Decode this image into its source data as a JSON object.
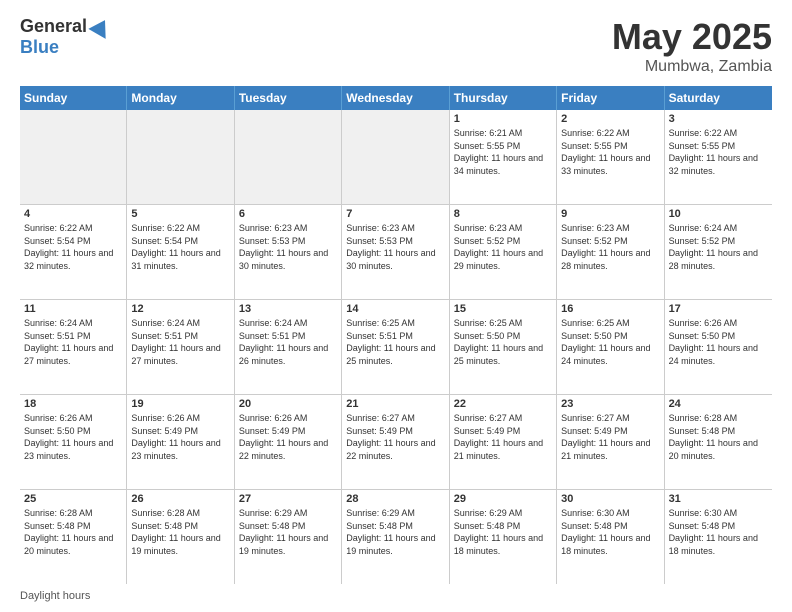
{
  "logo": {
    "general": "General",
    "blue": "Blue"
  },
  "title": {
    "month": "May 2025",
    "location": "Mumbwa, Zambia"
  },
  "header_days": [
    "Sunday",
    "Monday",
    "Tuesday",
    "Wednesday",
    "Thursday",
    "Friday",
    "Saturday"
  ],
  "weeks": [
    [
      {
        "day": "",
        "info": "",
        "shaded": true
      },
      {
        "day": "",
        "info": "",
        "shaded": true
      },
      {
        "day": "",
        "info": "",
        "shaded": true
      },
      {
        "day": "",
        "info": "",
        "shaded": true
      },
      {
        "day": "1",
        "info": "Sunrise: 6:21 AM\nSunset: 5:55 PM\nDaylight: 11 hours and 34 minutes.",
        "shaded": false
      },
      {
        "day": "2",
        "info": "Sunrise: 6:22 AM\nSunset: 5:55 PM\nDaylight: 11 hours and 33 minutes.",
        "shaded": false
      },
      {
        "day": "3",
        "info": "Sunrise: 6:22 AM\nSunset: 5:55 PM\nDaylight: 11 hours and 32 minutes.",
        "shaded": false
      }
    ],
    [
      {
        "day": "4",
        "info": "Sunrise: 6:22 AM\nSunset: 5:54 PM\nDaylight: 11 hours and 32 minutes.",
        "shaded": false
      },
      {
        "day": "5",
        "info": "Sunrise: 6:22 AM\nSunset: 5:54 PM\nDaylight: 11 hours and 31 minutes.",
        "shaded": false
      },
      {
        "day": "6",
        "info": "Sunrise: 6:23 AM\nSunset: 5:53 PM\nDaylight: 11 hours and 30 minutes.",
        "shaded": false
      },
      {
        "day": "7",
        "info": "Sunrise: 6:23 AM\nSunset: 5:53 PM\nDaylight: 11 hours and 30 minutes.",
        "shaded": false
      },
      {
        "day": "8",
        "info": "Sunrise: 6:23 AM\nSunset: 5:52 PM\nDaylight: 11 hours and 29 minutes.",
        "shaded": false
      },
      {
        "day": "9",
        "info": "Sunrise: 6:23 AM\nSunset: 5:52 PM\nDaylight: 11 hours and 28 minutes.",
        "shaded": false
      },
      {
        "day": "10",
        "info": "Sunrise: 6:24 AM\nSunset: 5:52 PM\nDaylight: 11 hours and 28 minutes.",
        "shaded": false
      }
    ],
    [
      {
        "day": "11",
        "info": "Sunrise: 6:24 AM\nSunset: 5:51 PM\nDaylight: 11 hours and 27 minutes.",
        "shaded": false
      },
      {
        "day": "12",
        "info": "Sunrise: 6:24 AM\nSunset: 5:51 PM\nDaylight: 11 hours and 27 minutes.",
        "shaded": false
      },
      {
        "day": "13",
        "info": "Sunrise: 6:24 AM\nSunset: 5:51 PM\nDaylight: 11 hours and 26 minutes.",
        "shaded": false
      },
      {
        "day": "14",
        "info": "Sunrise: 6:25 AM\nSunset: 5:51 PM\nDaylight: 11 hours and 25 minutes.",
        "shaded": false
      },
      {
        "day": "15",
        "info": "Sunrise: 6:25 AM\nSunset: 5:50 PM\nDaylight: 11 hours and 25 minutes.",
        "shaded": false
      },
      {
        "day": "16",
        "info": "Sunrise: 6:25 AM\nSunset: 5:50 PM\nDaylight: 11 hours and 24 minutes.",
        "shaded": false
      },
      {
        "day": "17",
        "info": "Sunrise: 6:26 AM\nSunset: 5:50 PM\nDaylight: 11 hours and 24 minutes.",
        "shaded": false
      }
    ],
    [
      {
        "day": "18",
        "info": "Sunrise: 6:26 AM\nSunset: 5:50 PM\nDaylight: 11 hours and 23 minutes.",
        "shaded": false
      },
      {
        "day": "19",
        "info": "Sunrise: 6:26 AM\nSunset: 5:49 PM\nDaylight: 11 hours and 23 minutes.",
        "shaded": false
      },
      {
        "day": "20",
        "info": "Sunrise: 6:26 AM\nSunset: 5:49 PM\nDaylight: 11 hours and 22 minutes.",
        "shaded": false
      },
      {
        "day": "21",
        "info": "Sunrise: 6:27 AM\nSunset: 5:49 PM\nDaylight: 11 hours and 22 minutes.",
        "shaded": false
      },
      {
        "day": "22",
        "info": "Sunrise: 6:27 AM\nSunset: 5:49 PM\nDaylight: 11 hours and 21 minutes.",
        "shaded": false
      },
      {
        "day": "23",
        "info": "Sunrise: 6:27 AM\nSunset: 5:49 PM\nDaylight: 11 hours and 21 minutes.",
        "shaded": false
      },
      {
        "day": "24",
        "info": "Sunrise: 6:28 AM\nSunset: 5:48 PM\nDaylight: 11 hours and 20 minutes.",
        "shaded": false
      }
    ],
    [
      {
        "day": "25",
        "info": "Sunrise: 6:28 AM\nSunset: 5:48 PM\nDaylight: 11 hours and 20 minutes.",
        "shaded": false
      },
      {
        "day": "26",
        "info": "Sunrise: 6:28 AM\nSunset: 5:48 PM\nDaylight: 11 hours and 19 minutes.",
        "shaded": false
      },
      {
        "day": "27",
        "info": "Sunrise: 6:29 AM\nSunset: 5:48 PM\nDaylight: 11 hours and 19 minutes.",
        "shaded": false
      },
      {
        "day": "28",
        "info": "Sunrise: 6:29 AM\nSunset: 5:48 PM\nDaylight: 11 hours and 19 minutes.",
        "shaded": false
      },
      {
        "day": "29",
        "info": "Sunrise: 6:29 AM\nSunset: 5:48 PM\nDaylight: 11 hours and 18 minutes.",
        "shaded": false
      },
      {
        "day": "30",
        "info": "Sunrise: 6:30 AM\nSunset: 5:48 PM\nDaylight: 11 hours and 18 minutes.",
        "shaded": false
      },
      {
        "day": "31",
        "info": "Sunrise: 6:30 AM\nSunset: 5:48 PM\nDaylight: 11 hours and 18 minutes.",
        "shaded": false
      }
    ]
  ],
  "footer": {
    "daylight_hours": "Daylight hours"
  }
}
